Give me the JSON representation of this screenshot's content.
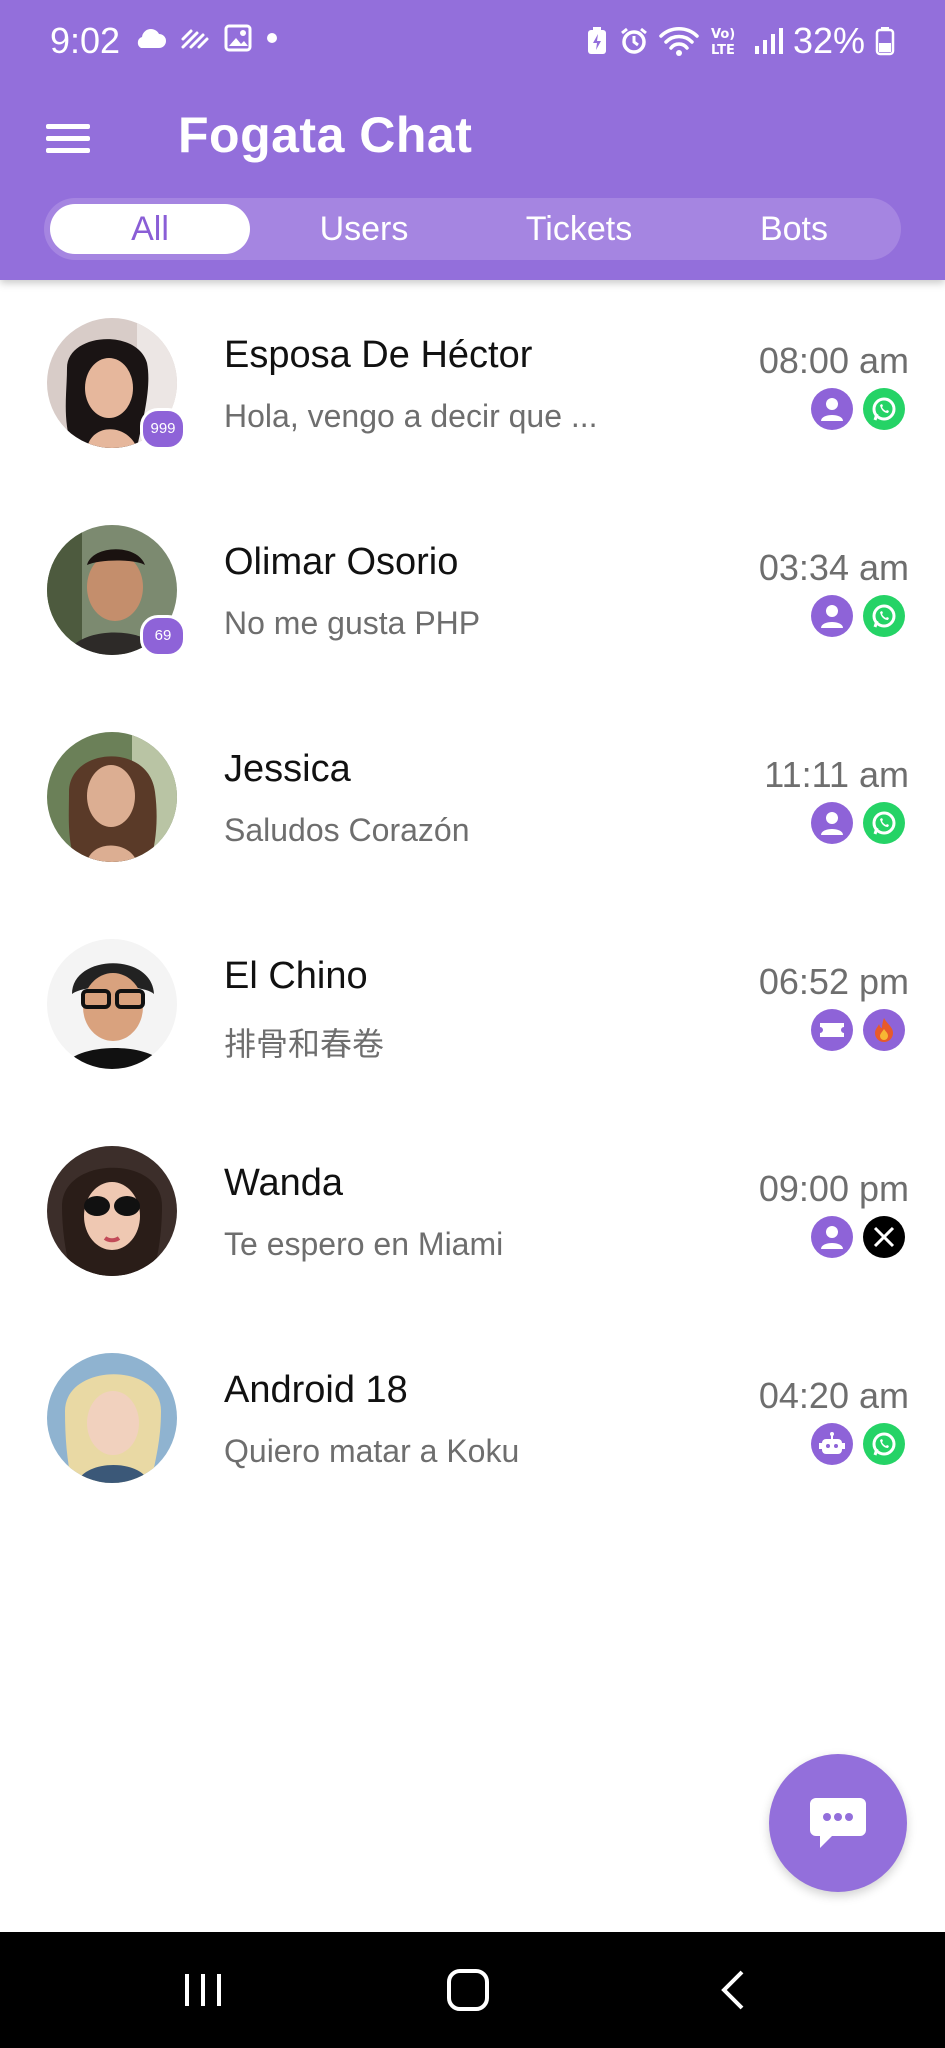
{
  "status_bar": {
    "time": "9:02",
    "battery": "32%"
  },
  "app": {
    "title": "Fogata Chat",
    "accent": "#936fdb"
  },
  "tabs": [
    {
      "label": "All",
      "active": true
    },
    {
      "label": "Users",
      "active": false
    },
    {
      "label": "Tickets",
      "active": false
    },
    {
      "label": "Bots",
      "active": false
    }
  ],
  "conversations": [
    {
      "name": "Esposa De Héctor",
      "preview": "Hola, vengo a decir que ...",
      "time": "08:00 am",
      "badge": "999",
      "type_icon": "user-icon",
      "channel_icon": "whatsapp-icon"
    },
    {
      "name": "Olimar Osorio",
      "preview": "No me gusta PHP",
      "time": "03:34 am",
      "badge": "69",
      "type_icon": "user-icon",
      "channel_icon": "whatsapp-icon"
    },
    {
      "name": "Jessica",
      "preview": "Saludos Corazón",
      "time": "11:11 am",
      "type_icon": "user-icon",
      "channel_icon": "whatsapp-icon"
    },
    {
      "name": "El Chino",
      "preview": "排骨和春卷",
      "time": "06:52 pm",
      "type_icon": "ticket-icon",
      "channel_icon": "fogata-flame-icon"
    },
    {
      "name": "Wanda",
      "preview": "Te espero en Miami",
      "time": "09:00 pm",
      "type_icon": "user-icon",
      "channel_icon": "x-icon"
    },
    {
      "name": "Android 18",
      "preview": "Quiero matar a Koku",
      "time": "04:20 am",
      "type_icon": "bot-icon",
      "channel_icon": "whatsapp-icon"
    }
  ]
}
